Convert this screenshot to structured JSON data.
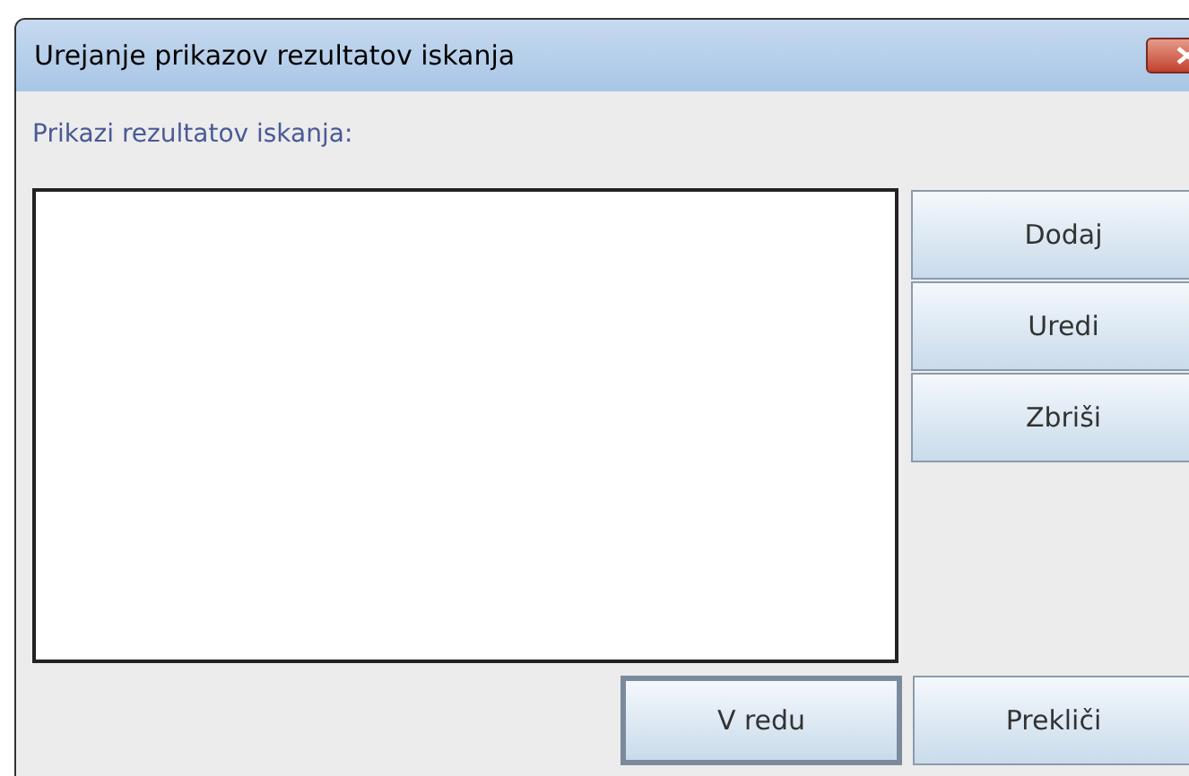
{
  "window": {
    "title": "Urejanje prikazov rezultatov iskanja"
  },
  "list_label": "Prikazi rezultatov iskanja:",
  "side_buttons": [
    "Dodaj",
    "Uredi",
    "Zbriši"
  ],
  "bottom_buttons": [
    {
      "label": "V redu",
      "default": true
    },
    {
      "label": "Prekliči",
      "default": false
    }
  ]
}
